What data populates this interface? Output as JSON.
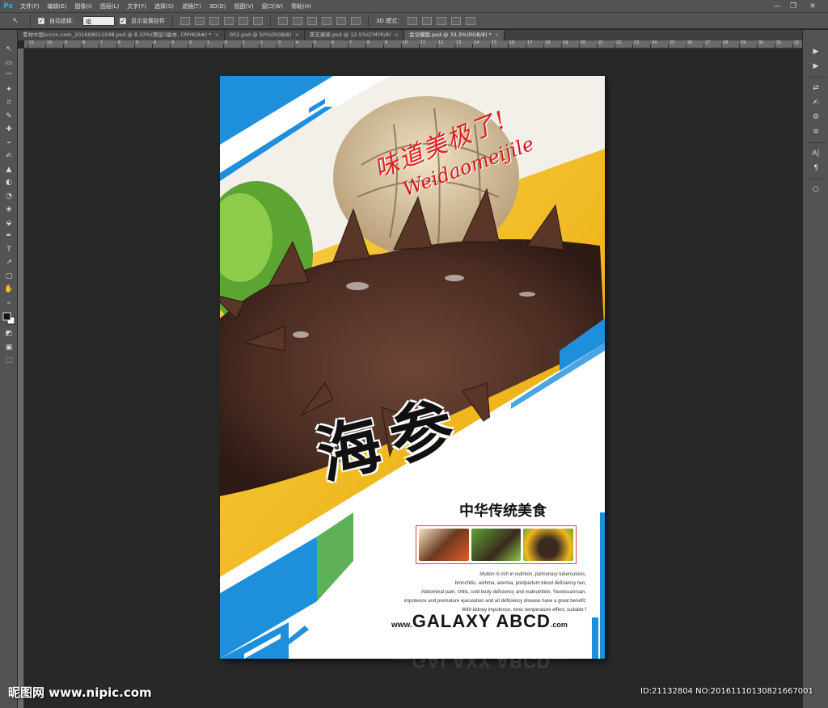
{
  "app": {
    "logo": "Ps"
  },
  "menu": [
    "文件(F)",
    "编辑(E)",
    "图像(I)",
    "图层(L)",
    "文字(Y)",
    "选择(S)",
    "滤镜(T)",
    "3D(D)",
    "视图(V)",
    "窗口(W)",
    "帮助(H)"
  ],
  "window_controls": {
    "minimize": "—",
    "restore": "❐",
    "close": "✕"
  },
  "options": {
    "auto_select_label": "自动选择：",
    "auto_select_value": "组",
    "show_transform_label": "显示变换控件",
    "mode_3d_label": "3D 模式："
  },
  "tabs": [
    {
      "label": "素材中国sccnn.com_201608011048.psd @ 8.33%(图层3副本, CMYK/8#) *",
      "close": "×"
    },
    {
      "label": "002.psd @ 50%(RGB/8)",
      "close": "×"
    },
    {
      "label": "茶艺展架.psd @ 12.5%(CMYK/8)",
      "close": "×"
    },
    {
      "label": "会议模版.psd @ 33.3%(RGB/8) *",
      "close": "×"
    }
  ],
  "ruler_labels": [
    "11",
    "10",
    "9",
    "8",
    "7",
    "6",
    "5",
    "4",
    "3",
    "2",
    "1",
    "0",
    "1",
    "2",
    "3",
    "4",
    "5",
    "6",
    "7",
    "8",
    "9",
    "10",
    "11",
    "12",
    "13",
    "14",
    "15",
    "16",
    "17",
    "18",
    "19",
    "20",
    "21",
    "22",
    "23",
    "24",
    "25",
    "26",
    "27",
    "28",
    "29",
    "30",
    "31",
    "32"
  ],
  "tools": [
    "↖",
    "▭",
    "⌒",
    "✦",
    "⌗",
    "✎",
    "✚",
    "⌁",
    "✍",
    "▲",
    "◐",
    "◔",
    "◈",
    "⬙",
    "✒",
    "T",
    "↗",
    "▢",
    "✋",
    "⌕",
    "◩",
    "▣",
    "⬚"
  ],
  "right_tools": [
    "▶",
    "▶",
    "⇄",
    "✍",
    "⚙",
    "≡",
    "A|",
    "¶",
    "⬡"
  ],
  "poster": {
    "slogan_cn": "味道美极了!",
    "slogan_pinyin": "Weidaomeijile",
    "title": "海参",
    "subtitle": "中华传统美食",
    "description": [
      "Mutton is rich in nutrition, pulmonary tuberculosis,",
      "bronchitis, asthma, anemia, postpartum blood deficiency two,",
      "Abdominal pain, chills, cold body deficiency and malnutrition, Yaoxisuanruan,",
      "impotence and premature ejaculation and all deficiency disease have a great benefit;",
      "With kidney impotence, tonic temperature effect, suitable f"
    ],
    "website_prefix": "www.",
    "website_main": "GALAXY ABCD",
    "website_suffix": ".com"
  },
  "watermarks": {
    "left": "昵图网 www.nipic.com",
    "right": "ID:21132804 NO:20161110130821667001"
  },
  "colors": {
    "accent_blue": "#1e8fdb",
    "accent_green": "#5fb158",
    "sauce_yellow": "#f0b820",
    "sea_cucumber": "#4a2c22",
    "red_text": "#e02020"
  }
}
